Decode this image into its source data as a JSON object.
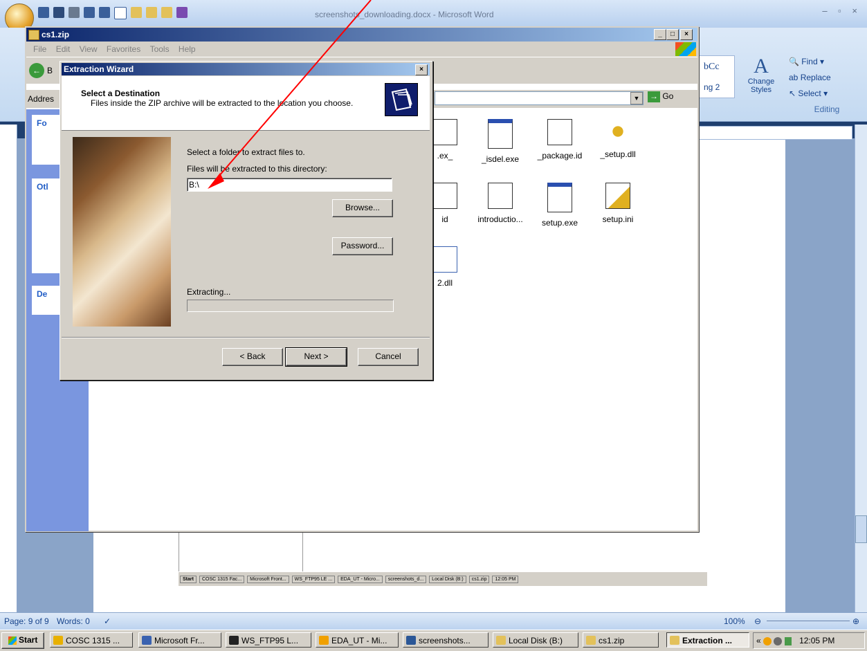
{
  "word": {
    "window_title": "screenshots_downloading.docx - Microsoft Word",
    "ribbon": {
      "styles_sample": "bCc",
      "heading_sample": "ng 2",
      "change_styles": "Change Styles",
      "editing": {
        "find": "Find",
        "replace": "Replace",
        "select": "Select",
        "group_label": "Editing"
      }
    },
    "status": {
      "page": "Page: 9 of 9",
      "words": "Words: 0",
      "zoom": "100%"
    }
  },
  "explorer": {
    "title": "cs1.zip",
    "menu": [
      "File",
      "Edit",
      "View",
      "Favorites",
      "Tools",
      "Help"
    ],
    "address_label": "Addres",
    "go_label": "Go",
    "back_label": "B",
    "left_panels": {
      "panel1": "Fo",
      "panel2": "Otl",
      "panel3": "De"
    },
    "files": [
      {
        "name": ".ex_",
        "type": "file"
      },
      {
        "name": "_isdel.exe",
        "type": "app"
      },
      {
        "name": "_package.id",
        "type": "doc"
      },
      {
        "name": "_setup.dll",
        "type": "dll"
      },
      {
        "name": "id",
        "type": "file"
      },
      {
        "name": "introductio...",
        "type": "doc"
      },
      {
        "name": "setup.exe",
        "type": "app"
      },
      {
        "name": "setup.ini",
        "type": "ini"
      },
      {
        "name": "2.dll",
        "type": "dll"
      }
    ]
  },
  "wizard": {
    "title": "Extraction Wizard",
    "heading": "Select a Destination",
    "subheading": "Files inside the ZIP archive will be extracted to the location you choose.",
    "select_folder_label": "Select a folder to extract files to.",
    "directory_label": "Files will be extracted to this directory:",
    "directory_value": "B:\\",
    "browse_label": "Browse...",
    "password_label": "Password...",
    "extracting_label": "Extracting...",
    "back_label": "< Back",
    "next_label": "Next >",
    "cancel_label": "Cancel",
    "progress": 0
  },
  "taskbar": {
    "start": "Start",
    "tasks": [
      {
        "label": "COSC 1315 ...",
        "color": "#e8b000"
      },
      {
        "label": "Microsoft Fr...",
        "color": "#3a62b0"
      },
      {
        "label": "WS_FTP95 L...",
        "color": "#222222"
      },
      {
        "label": "EDA_UT - Mi...",
        "color": "#f0a000"
      },
      {
        "label": "screenshots...",
        "color": "#2b5797"
      },
      {
        "label": "Local Disk (B:)",
        "color": "#e3c15a"
      },
      {
        "label": "cs1.zip",
        "color": "#e3c15a"
      },
      {
        "label": "Extraction ...",
        "color": "#e3c15a",
        "active": true
      }
    ],
    "clock": "12:05 PM"
  },
  "inner_screenshot_taskbar": {
    "start": "Start",
    "tasks": [
      "COSC 1315 Fac...",
      "Microsoft Front...",
      "WS_FTP95 LE ...",
      "EDA_UT - Micro...",
      "screenshots_d...",
      "Local Disk (B:)",
      "cs1.zip"
    ],
    "clock": "12:05 PM"
  },
  "colors": {
    "word_blue": "#15428b",
    "xp_title": "#0a246a",
    "annotation_arrow": "#ff0000"
  }
}
